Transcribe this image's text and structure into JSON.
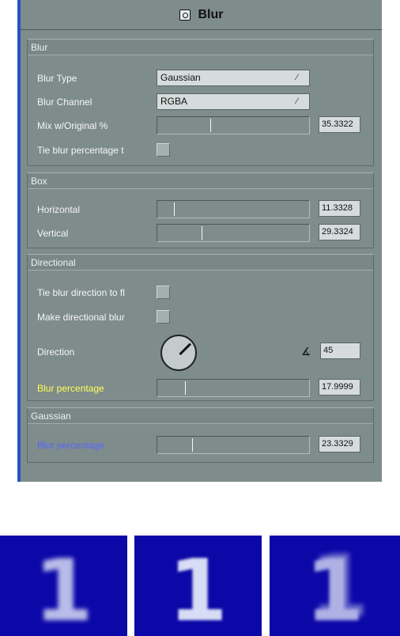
{
  "panel": {
    "title": "Blur",
    "sections": {
      "blur": {
        "header": "Blur",
        "blur_type_label": "Blur Type",
        "blur_type_value": "Gaussian",
        "blur_channel_label": "Blur Channel",
        "blur_channel_value": "RGBA",
        "mix_label": "Mix w/Original %",
        "mix_value": "35.3322",
        "mix_fraction": 0.35,
        "tie_label": "Tie blur percentage t"
      },
      "box": {
        "header": "Box",
        "horizontal_label": "Horizontal",
        "horizontal_value": "11.3328",
        "horizontal_fraction": 0.11,
        "vertical_label": "Vertical",
        "vertical_value": "29.3324",
        "vertical_fraction": 0.29
      },
      "directional": {
        "header": "Directional",
        "tie_direction_label": "Tie blur direction to fl",
        "make_directional_label": "Make directional blur",
        "direction_label": "Direction",
        "direction_value": "45",
        "blur_pct_label": "Blur percentage",
        "blur_pct_value": "17.9999",
        "blur_pct_fraction": 0.18
      },
      "gaussian": {
        "header": "Gaussian",
        "blur_pct_label": "Blur percentage",
        "blur_pct_value": "23.3329",
        "blur_pct_fraction": 0.23
      }
    }
  },
  "previews": [
    {
      "glyph": "1",
      "style": "box blur"
    },
    {
      "glyph": "1",
      "style": "gaussian blur"
    },
    {
      "glyph": "1",
      "style": "directional blur"
    }
  ],
  "colors": {
    "panel_bg": "#7f8c8c",
    "accent_border": "#2452c6",
    "label_yellow": "#ffff55",
    "label_blue": "#5566ff",
    "preview_bg": "#0c08a8"
  },
  "icons": {
    "title": "blur-effect-icon",
    "dropdown_arrow": "dropdown-arrow-icon",
    "angle": "angle-icon"
  }
}
